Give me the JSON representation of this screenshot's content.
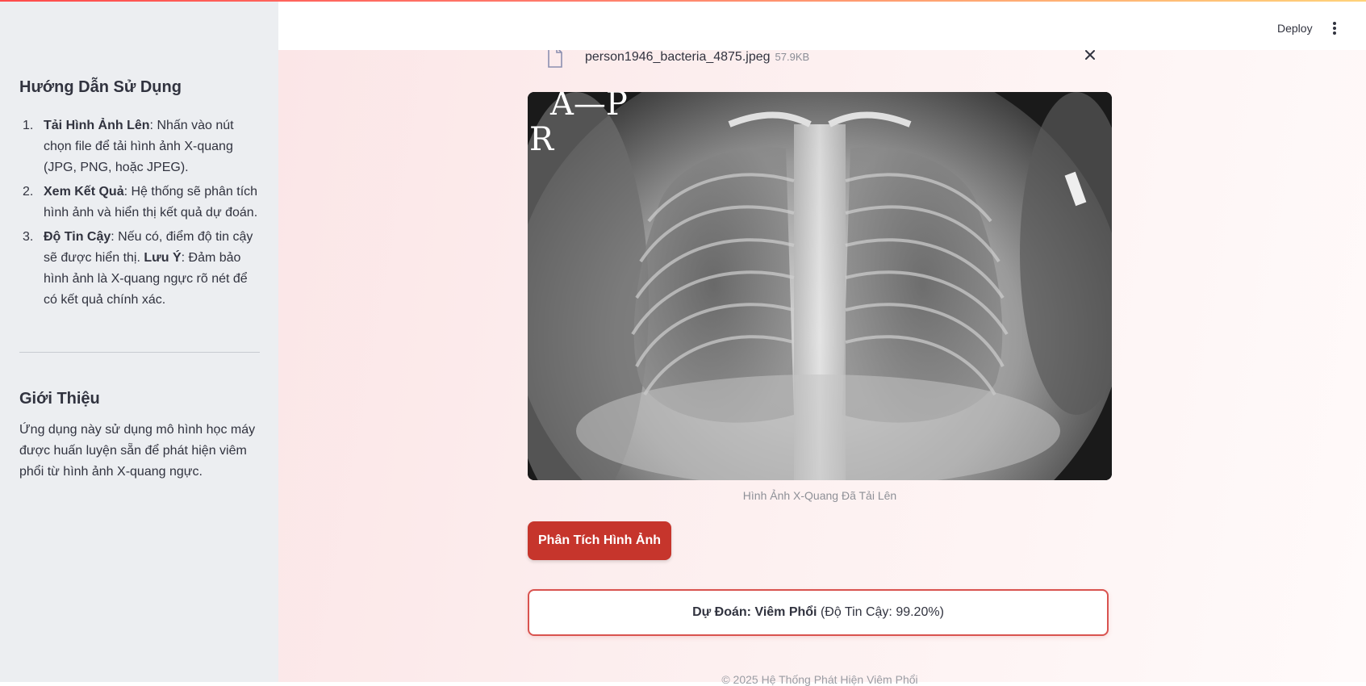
{
  "header": {
    "deploy_label": "Deploy",
    "menu_icon": "kebab-menu-icon"
  },
  "sidebar": {
    "guide_title": "Hướng Dẫn Sử Dụng",
    "steps": [
      {
        "num": "1.",
        "bold": "Tải Hình Ảnh Lên",
        "text": ": Nhấn vào nút chọn file để tải hình ảnh X-quang (JPG, PNG, hoặc JPEG)."
      },
      {
        "num": "2.",
        "bold": "Xem Kết Quả",
        "text": ": Hệ thống sẽ phân tích hình ảnh và hiển thị kết quả dự đoán."
      },
      {
        "num": "3.",
        "bold": "Độ Tin Cậy",
        "text": ": Nếu có, điểm độ tin cậy sẽ được hiển thị. ",
        "bold2": "Lưu Ý",
        "text2": ": Đảm bảo hình ảnh là X-quang ngực rõ nét để có kết quả chính xác."
      }
    ],
    "intro_title": "Giới Thiệu",
    "intro_text": "Ứng dụng này sử dụng mô hình học máy được huấn luyện sẵn để phát hiện viêm phổi từ hình ảnh X-quang ngực."
  },
  "upload": {
    "file_name": "person1946_bacteria_4875.jpeg",
    "file_size": "57.9KB",
    "file_icon": "file-icon",
    "remove_icon": "close-icon"
  },
  "image": {
    "overlay_top": "A—P",
    "overlay_side": "R",
    "caption": "Hình Ảnh X-Quang Đã Tải Lên"
  },
  "analyze_button": "Phân Tích Hình Ảnh",
  "result": {
    "label": "Dự Đoán: Viêm Phổi",
    "confidence": "(Độ Tin Cậy: 99.20%)"
  },
  "footer": "© 2025 Hệ Thống Phát Hiện Viêm Phổi",
  "colors": {
    "accent": "#c6352c",
    "sidebar_bg": "#eceef1",
    "result_border": "#d9534f"
  }
}
